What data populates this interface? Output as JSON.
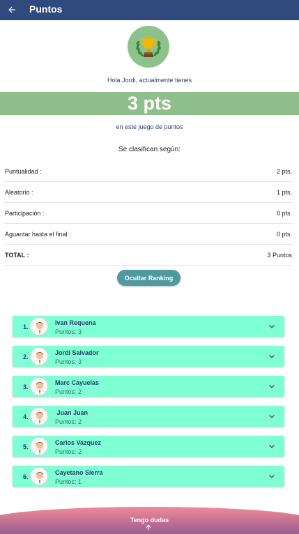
{
  "header": {
    "title": "Puntos",
    "back_icon": "arrow-left-icon"
  },
  "trophy": {
    "icon": "trophy-icon",
    "bg_color": "#8dc38b"
  },
  "greeting": "Hola Jordi, actualmente tienes",
  "points_display": "3 pts",
  "game_text": "en este juego de puntos",
  "classify_text": "Se clasifican según:",
  "score_rows": [
    {
      "label": "Puntualidad :",
      "value": "2 pts."
    },
    {
      "label": "Aleatorio :",
      "value": "1 pts."
    },
    {
      "label": "Participación :",
      "value": "0 pts."
    },
    {
      "label": "Aguantar hasta el final :",
      "value": "0 pts."
    }
  ],
  "total": {
    "label": "TOTAL :",
    "value": "3 Puntos"
  },
  "ranking_button": "Ocultar Ranking",
  "ranking": [
    {
      "position": "1.",
      "name": "Ivan Requena",
      "points": "Puntos: 3"
    },
    {
      "position": "2.",
      "name": "Jordi Salvador",
      "points": "Puntos: 3"
    },
    {
      "position": "3.",
      "name": "Marc Cayuelas",
      "points": "Puntos: 2"
    },
    {
      "position": "4.",
      "name": " Juan Juan",
      "points": "Puntos: 2"
    },
    {
      "position": "5.",
      "name": "Carlos Vazquez",
      "points": "Puntos: 2"
    },
    {
      "position": "6.",
      "name": "Cayetano Sierra",
      "points": "Puntos: 1"
    }
  ],
  "help": {
    "label": "Tengo dudas",
    "icon": "arrow-up-icon"
  },
  "colors": {
    "header": "#314a7d",
    "banner": "#8fbf8b",
    "card": "#7fffd4",
    "button": "#4e9aa0"
  }
}
